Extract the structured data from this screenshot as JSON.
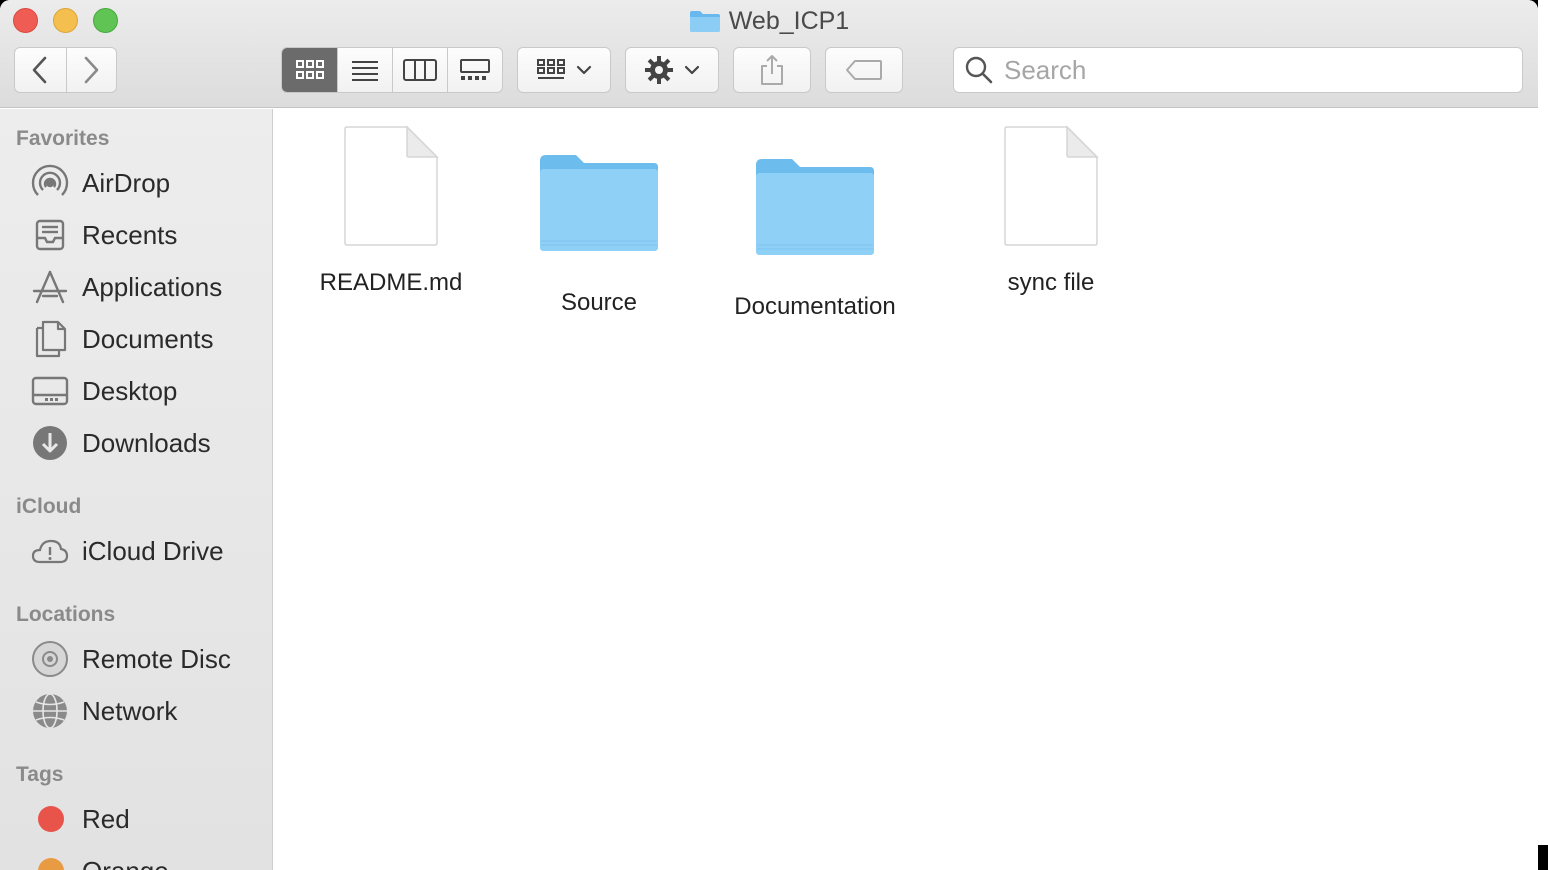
{
  "window": {
    "title": "Web_ICP1"
  },
  "toolbar": {
    "back_icon": "chevron-left-icon",
    "forward_icon": "chevron-right-icon",
    "view_modes": [
      "icon-view",
      "list-view",
      "column-view",
      "gallery-view"
    ],
    "active_view": "icon-view",
    "search_placeholder": "Search",
    "search_value": ""
  },
  "sidebar": {
    "sections": {
      "favorites": "Favorites",
      "icloud": "iCloud",
      "locations": "Locations",
      "tags": "Tags"
    },
    "favorites": [
      {
        "label": "AirDrop",
        "icon": "airdrop-icon"
      },
      {
        "label": "Recents",
        "icon": "recents-icon"
      },
      {
        "label": "Applications",
        "icon": "applications-icon"
      },
      {
        "label": "Documents",
        "icon": "documents-icon"
      },
      {
        "label": "Desktop",
        "icon": "desktop-icon"
      },
      {
        "label": "Downloads",
        "icon": "downloads-icon"
      }
    ],
    "icloud": [
      {
        "label": "iCloud Drive",
        "icon": "icloud-drive-icon"
      }
    ],
    "locations": [
      {
        "label": "Remote Disc",
        "icon": "remote-disc-icon"
      },
      {
        "label": "Network",
        "icon": "network-icon"
      }
    ],
    "tags": [
      {
        "label": "Red",
        "color": "#e8534a"
      },
      {
        "label": "Orange",
        "color": "#e99b43"
      }
    ]
  },
  "files": [
    {
      "name": "README.md",
      "kind": "document"
    },
    {
      "name": "Source",
      "kind": "folder"
    },
    {
      "name": "Documentation",
      "kind": "folder"
    },
    {
      "name": "sync file",
      "kind": "document"
    }
  ],
  "colors": {
    "folder": "#7cc4f2",
    "folder_dark": "#5fb1ea",
    "active_view_bg": "#6b6b6b"
  }
}
